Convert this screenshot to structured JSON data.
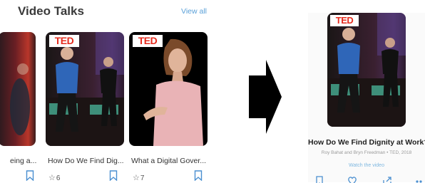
{
  "left": {
    "section_title": "Video Talks",
    "view_all_label": "View all",
    "cards": [
      {
        "title": "eing a..."
      },
      {
        "badge": "TED",
        "title": "How Do We Find Dig...",
        "star_count": "6"
      },
      {
        "badge": "TED",
        "title": "What a Digital Gover...",
        "star_count": "7"
      }
    ]
  },
  "right": {
    "badge": "TED",
    "title": "How Do We Find Dignity at Work?",
    "byline": "Roy Bahat and Bryn Freedman • TED, 2018",
    "watch_label": "Watch the video"
  },
  "icons": {
    "bookmark": "bookmark-icon",
    "star": "star-outline-icon",
    "heart": "heart-icon",
    "share": "share-icon",
    "more": "more-icon"
  },
  "colors": {
    "ted_red": "#e62b1e",
    "link_blue": "#5aa0d8",
    "bookmark_blue": "#4a8fd0"
  }
}
